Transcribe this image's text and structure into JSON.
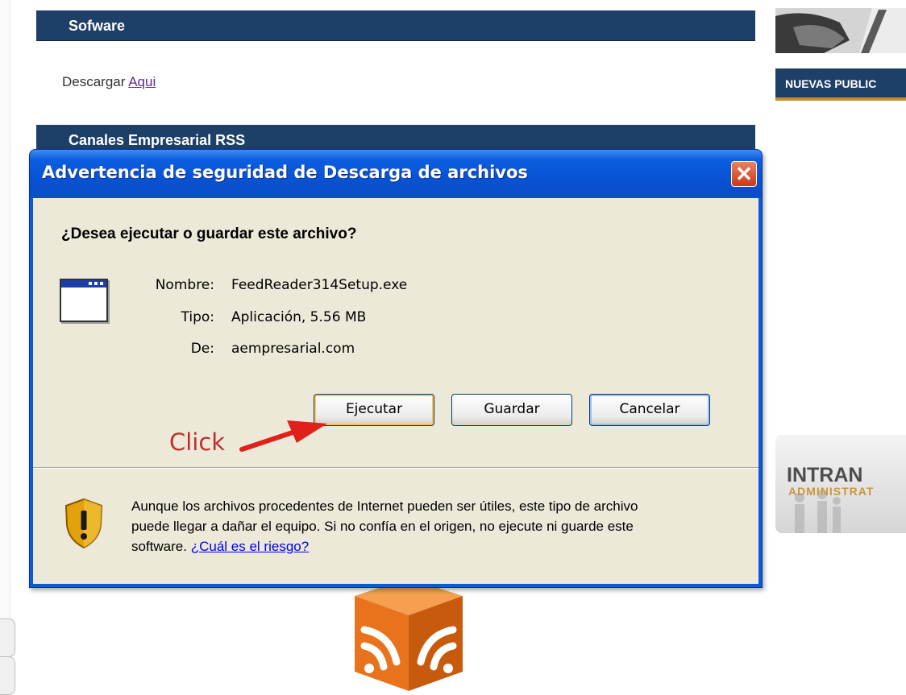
{
  "page": {
    "software_header": "Sofware",
    "download_text": "Descargar",
    "download_link": "Aqui",
    "rss_header": "Canales Empresarial RSS",
    "right_banner": "NUEVAS PUBLIC",
    "intranet_title": "INTRAN",
    "intranet_subtitle": "ADMINISTRAT"
  },
  "dialog": {
    "title": "Advertencia de seguridad de Descarga de archivos",
    "close_glyph": "✕",
    "question": "¿Desea ejecutar o guardar este archivo?",
    "file": {
      "name_label": "Nombre:",
      "name_value": "FeedReader314Setup.exe",
      "type_label": "Tipo:",
      "type_value": "Aplicación, 5.56 MB",
      "from_label": "De:",
      "from_value": "aempresarial.com"
    },
    "buttons": {
      "run": "Ejecutar",
      "save": "Guardar",
      "cancel": "Cancelar"
    },
    "annotation": "Click",
    "warning_text": "Aunque los archivos procedentes de Internet pueden ser útiles, este tipo de archivo puede llegar a dañar el equipo. Si no confía en el origen, no ejecute ni guarde este software.",
    "risk_link": "¿Cuál es el riesgo?"
  },
  "colors": {
    "header_navy": "#1e3f68",
    "titlebar_blue": "#0a5bd6",
    "dialog_face": "#ece9d8",
    "annotation_red": "#c0302b",
    "rss_orange": "#e8731c"
  },
  "icons": [
    "file-window-icon",
    "security-shield-icon",
    "close-icon",
    "rss-feed-icon",
    "red-arrow-icon"
  ]
}
